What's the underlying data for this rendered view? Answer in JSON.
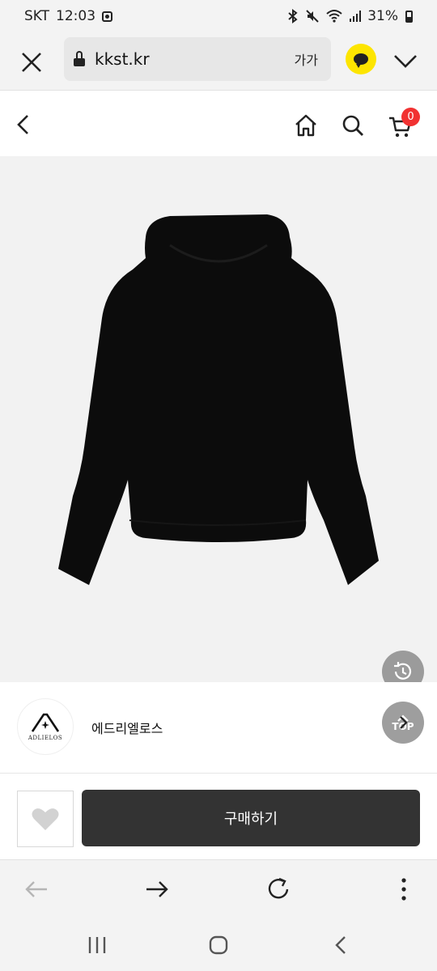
{
  "status_bar": {
    "carrier": "SKT",
    "time": "12:03",
    "battery": "31%"
  },
  "browser": {
    "url": "kkst.kr",
    "font_size_label": "가가"
  },
  "header": {
    "cart_count": "0"
  },
  "product": {
    "image_alt": "black hoodie"
  },
  "floating": {
    "top_label": "TOP"
  },
  "shop": {
    "name": "에드리엘로스",
    "logo_text": "ADLIELOS"
  },
  "purchase": {
    "buy_label": "구매하기"
  },
  "colors": {
    "buy_button": "#333333",
    "cart_badge": "#f13232",
    "kakao_yellow": "#fde500"
  }
}
